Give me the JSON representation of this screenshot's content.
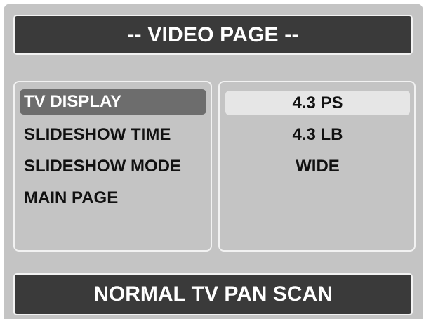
{
  "title": "-- VIDEO PAGE --",
  "menu": {
    "items": [
      {
        "label": "TV DISPLAY",
        "selected": true
      },
      {
        "label": "SLIDESHOW TIME",
        "selected": false
      },
      {
        "label": "SLIDESHOW MODE",
        "selected": false
      },
      {
        "label": "MAIN PAGE",
        "selected": false
      }
    ]
  },
  "options": {
    "items": [
      {
        "label": "4.3 PS",
        "selected": true
      },
      {
        "label": "4.3 LB",
        "selected": false
      },
      {
        "label": "WIDE",
        "selected": false
      }
    ]
  },
  "status": "NORMAL TV PAN SCAN",
  "colors": {
    "background": "#c4c4c4",
    "bar": "#3a3a3a",
    "highlight_menu": "#6d6d6d",
    "highlight_option": "#e6e6e6",
    "border": "#f2f2f2"
  }
}
